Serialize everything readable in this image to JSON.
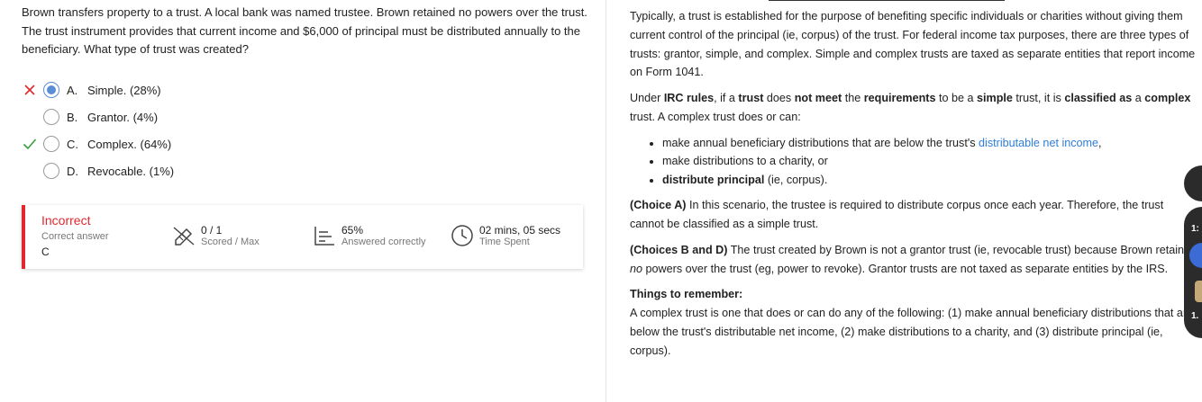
{
  "question": {
    "text": "Brown transfers property to a trust.  A local bank was named trustee.  Brown retained no powers over the trust.  The trust instrument provides that current income and $6,000 of principal must be distributed annually to the beneficiary.  What type of trust was created?"
  },
  "choices": [
    {
      "letter": "A.",
      "text": "Simple. (28%)",
      "status": "wrong",
      "selected": true
    },
    {
      "letter": "B.",
      "text": "Grantor. (4%)",
      "status": "",
      "selected": false
    },
    {
      "letter": "C.",
      "text": "Complex. (64%)",
      "status": "correct",
      "selected": false
    },
    {
      "letter": "D.",
      "text": "Revocable. (1%)",
      "status": "",
      "selected": false
    }
  ],
  "result": {
    "status": "Incorrect",
    "correct_answer_label": "Correct answer",
    "correct_answer": "C",
    "score_value": "0 / 1",
    "score_label": "Scored / Max",
    "pct_value": "65%",
    "pct_label": "Answered correctly",
    "time_value": "02 mins, 05 secs",
    "time_label": "Time Spent"
  },
  "explanation": {
    "p1": "Typically, a trust is established for the purpose of benefiting specific individuals or charities without giving them current control of the principal (ie, corpus) of the trust.  For federal income tax purposes, there are three types of trusts: grantor, simple, and complex.  Simple and complex trusts are taxed as separate entities that report income on Form 1041.",
    "p2_a": "Under ",
    "p2_b": "IRC rules",
    "p2_c": ", if a ",
    "p2_d": "trust",
    "p2_e": " does ",
    "p2_f": "not meet",
    "p2_g": " the ",
    "p2_h": "requirements",
    "p2_i": " to be a ",
    "p2_j": "simple",
    "p2_k": " trust, it is ",
    "p2_l": "classified as",
    "p2_m": " a ",
    "p2_n": "complex",
    "p2_o": " trust.  A complex trust does or can:",
    "b1_a": "make annual beneficiary distributions that are below the trust's ",
    "b1_link": "distributable net income",
    "b1_c": ",",
    "b2": "make distributions to a charity, or",
    "b3_a": "distribute principal",
    "b3_b": " (ie, corpus).",
    "p3_a": "(Choice A)",
    "p3_b": "  In this scenario, the trustee is required to distribute corpus once each year.  Therefore, the trust cannot be classified as a simple trust.",
    "p4_a": "(Choices B and D)",
    "p4_b": "  The trust created by Brown is not a grantor trust (ie, revocable trust) because Brown retained ",
    "p4_c": "no",
    "p4_d": " powers over the trust (eg, power to revoke).  Grantor trusts are not taxed as separate entities by the IRS.",
    "remember_title": "Things to remember:",
    "remember_text": "A complex trust is one that does or can do any of the following: (1) make annual beneficiary distributions that are below the trust's distributable net income, (2) make distributions to a charity, and (3) distribute principal (ie, corpus)."
  },
  "side_widgets": {
    "w1": "1:",
    "w2": "1."
  },
  "colors": {
    "incorrect": "#e0282e",
    "correct": "#3aa03a",
    "link": "#2f7ed8",
    "selected": "#5a8fd8"
  }
}
